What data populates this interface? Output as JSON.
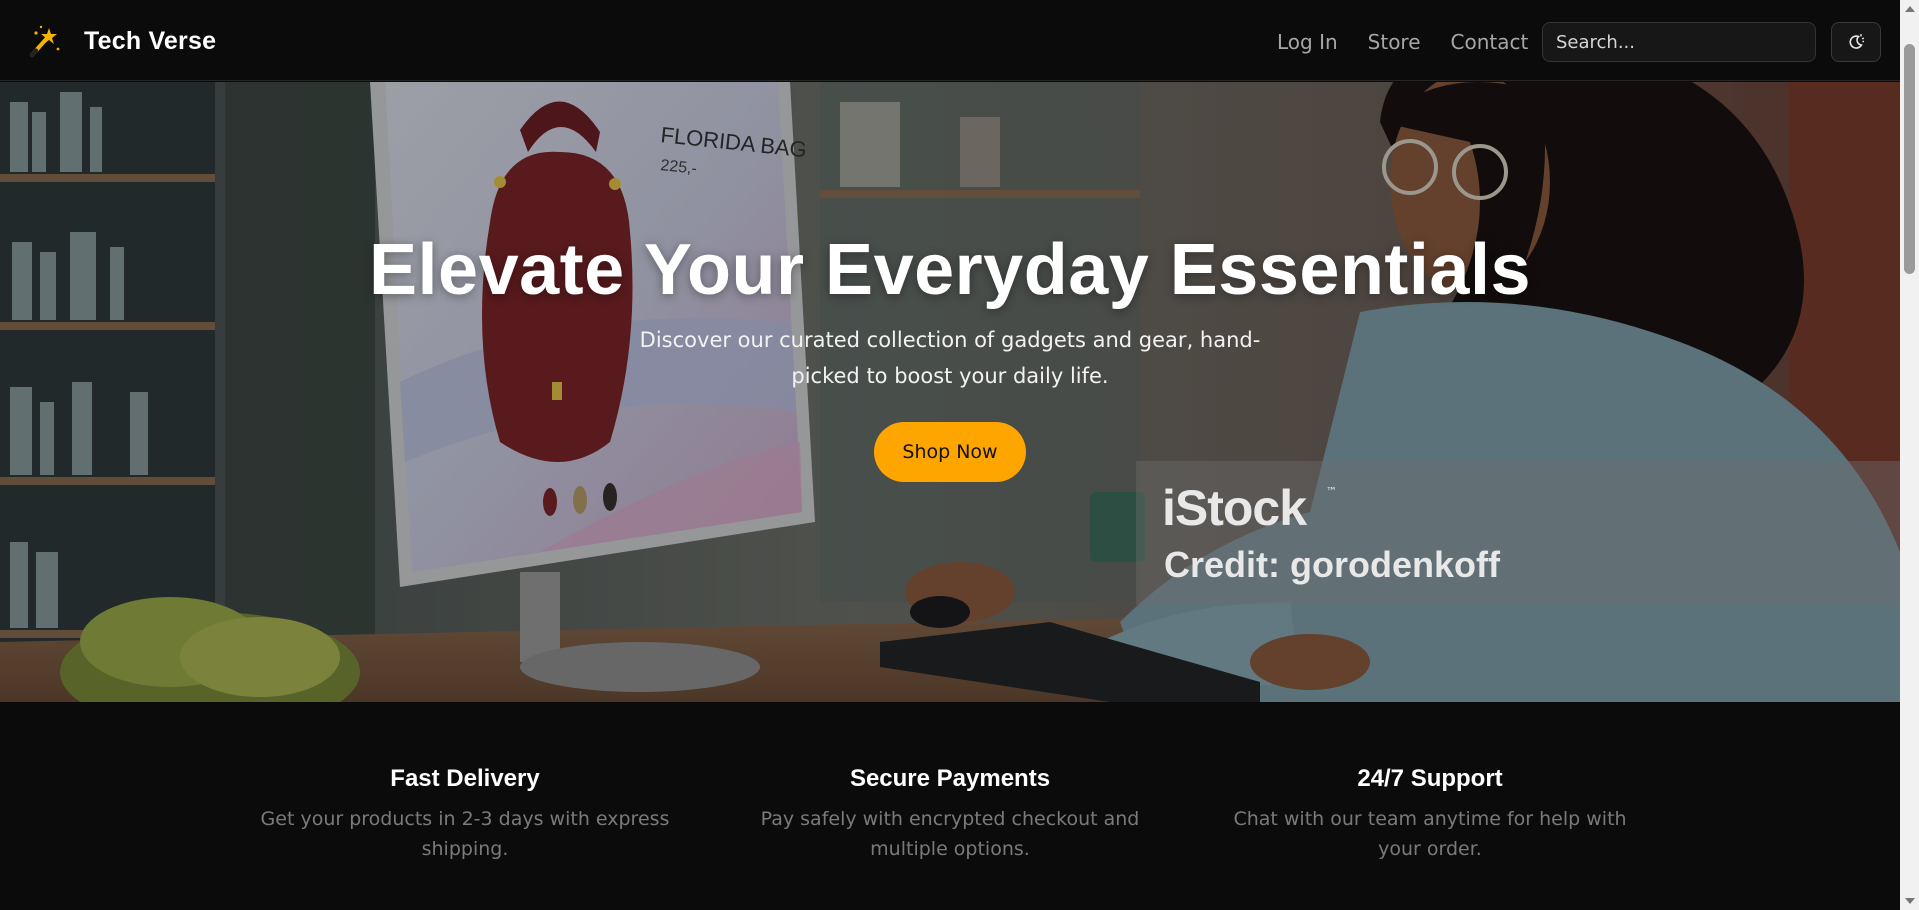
{
  "app": {
    "brand_name": "Tech Verse",
    "brand_icon": "magic-wand-icon"
  },
  "nav": {
    "links": [
      {
        "label": "Log In"
      },
      {
        "label": "Store"
      },
      {
        "label": "Contact"
      }
    ],
    "search_placeholder": "Search...",
    "theme_toggle_icon": "sun-moon-icon"
  },
  "hero": {
    "title": "Elevate Your Everyday Essentials",
    "subtitle": "Discover our curated collection of gadgets and gear, hand-picked to boost your daily life.",
    "cta_label": "Shop Now",
    "image_watermark": {
      "brand": "iStock",
      "trademark": "™",
      "credit": "Credit: gorodenkoff"
    },
    "screen_product": {
      "name": "FLORIDA BAG",
      "price": "225,-"
    }
  },
  "features": [
    {
      "title": "Fast Delivery",
      "description": "Get your products in 2-3 days with express shipping."
    },
    {
      "title": "Secure Payments",
      "description": "Pay safely with encrypted checkout and multiple options."
    },
    {
      "title": "24/7 Support",
      "description": "Chat with our team anytime for help with your order."
    }
  ],
  "colors": {
    "background": "#0b0b0b",
    "accent": "#ffa500",
    "muted_text": "#7a7a7a",
    "nav_text": "#a6a6a6"
  }
}
